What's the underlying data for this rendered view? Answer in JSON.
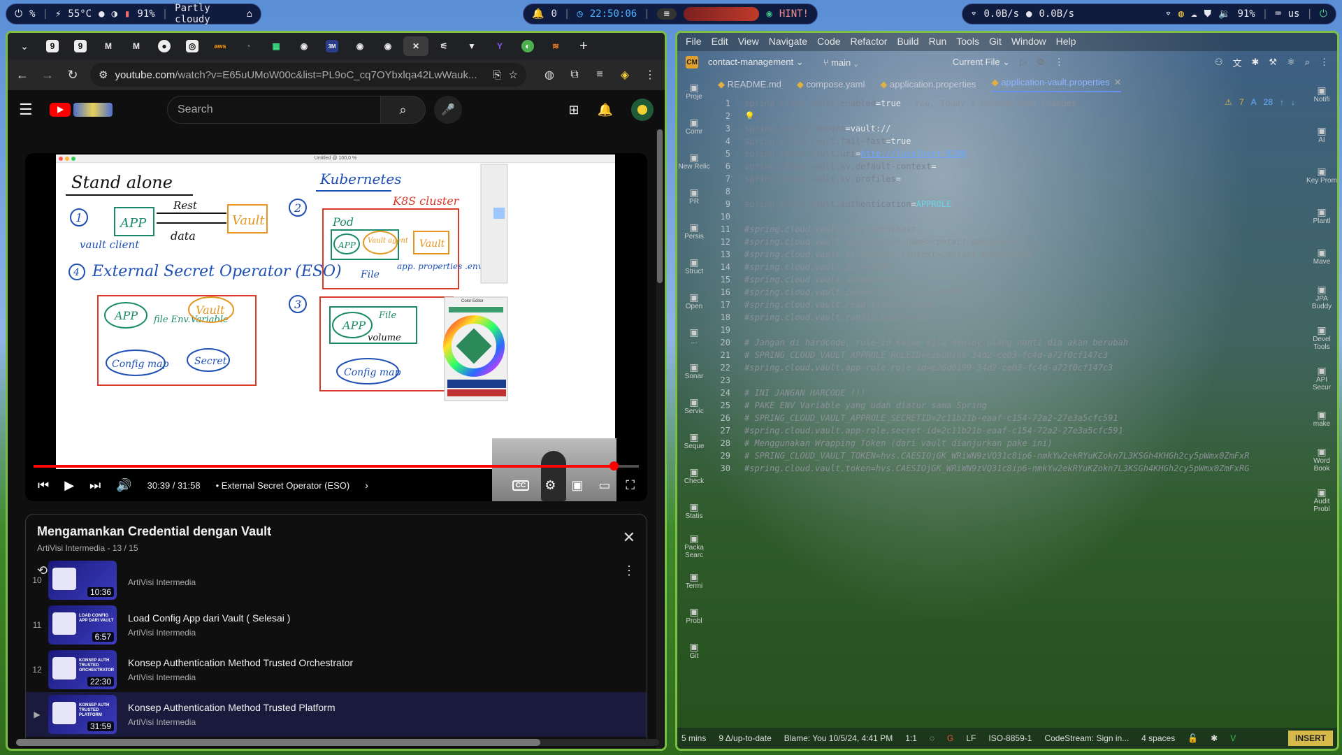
{
  "topbar": {
    "left": {
      "temp": "55°C",
      "battery": "91%",
      "weather": "Partly cloudy"
    },
    "center": {
      "notifications": "0",
      "clock": "22:50:06",
      "hint": "HINT!"
    },
    "right": {
      "net_up": "0.0B/s",
      "net_down": "0.0B/s",
      "volume": "91%",
      "lang": "us"
    }
  },
  "browser": {
    "url_main": "youtube.com",
    "url_rest": "/watch?v=E65uUMoW00c&list=PL9oC_cq7OYbxlqa42LwWauk...",
    "search_placeholder": "Search"
  },
  "video": {
    "canvas_title": "Untitled @ 100,0 %",
    "time": "30:39 / 31:58",
    "chapter": "• External Secret Operator (ESO)",
    "progress_fraction": 0.959,
    "whiteboard": {
      "standalone": "Stand alone",
      "kubernetes": "Kubernetes",
      "k8s_cluster": "K8S cluster",
      "app": "APP",
      "rest": "Rest",
      "vault": "Vault",
      "data": "data",
      "vault_client": "vault client",
      "pod": "Pod",
      "vault_agent": "Vault agent",
      "file": "File",
      "app_properties": "app. properties .env",
      "eso": "External Secret Operator (ESO)",
      "file_env": "file Env.Variable",
      "config_map": "Config map",
      "secret": "Secret",
      "volume": "volume",
      "n1": "1",
      "n2": "2",
      "n3": "3",
      "n4": "4",
      "color_editor": "Color Editor"
    }
  },
  "playlist": {
    "title": "Mengamankan Credential dengan Vault",
    "channel": "ArtiVisi Intermedia",
    "position": "13 / 15",
    "items": [
      {
        "index": "10",
        "title": "",
        "channel": "ArtiVisi Intermedia",
        "duration": "10:36",
        "thumb": "",
        "current": false
      },
      {
        "index": "11",
        "title": "Load Config App dari Vault ( Selesai )",
        "channel": "ArtiVisi Intermedia",
        "duration": "6:57",
        "thumb": "LOAD CONFIG APP DARI VAULT",
        "current": false
      },
      {
        "index": "12",
        "title": "Konsep Authentication Method Trusted Orchestrator",
        "channel": "ArtiVisi Intermedia",
        "duration": "22:30",
        "thumb": "KONSEP AUTH TRUSTED ORCHESTRATOR",
        "current": false
      },
      {
        "index": "▶",
        "title": "Konsep Authentication Method Trusted Platform",
        "channel": "ArtiVisi Intermedia",
        "duration": "31:59",
        "thumb": "KONSEP AUTH TRUSTED PLATFORM",
        "current": true
      }
    ]
  },
  "ide": {
    "menu": [
      "File",
      "Edit",
      "View",
      "Navigate",
      "Code",
      "Refactor",
      "Build",
      "Run",
      "Tools",
      "Git",
      "Window",
      "Help"
    ],
    "project_badge": "CM",
    "project": "contact-management",
    "branch": "main",
    "run_config": "Current File",
    "tabs": [
      {
        "label": "README.md",
        "active": false
      },
      {
        "label": "compose.yaml",
        "active": false
      },
      {
        "label": "application.properties",
        "active": false
      },
      {
        "label": "application-vault.properties",
        "active": true
      }
    ],
    "left_rail": [
      "Proje",
      "Comr",
      "New Relic",
      "PR",
      "Persis",
      "Struct",
      "Open",
      "…",
      "Sonar",
      "Servic",
      "Seque",
      "Check",
      "Statis",
      "Packa Searc",
      "Termi",
      "Probl",
      "Git"
    ],
    "right_rail": [
      "Notifi",
      "AI",
      "Key Prom",
      "Plantl",
      "Mave",
      "JPA Buddy",
      "Devel Tools",
      "API Secur",
      "make",
      "Word Book",
      "Audit Probl"
    ],
    "inspections": {
      "warnings": "7",
      "typos": "28"
    },
    "blame_hint": "You, Today • Uncommitted changes",
    "lines": [
      {
        "n": "1",
        "text": "spring.cloud.vault.enabled=true"
      },
      {
        "n": "2",
        "text": ""
      },
      {
        "n": "3",
        "text": "spring.config.import=vault://"
      },
      {
        "n": "4",
        "text": "spring.cloud.vault.fail-fast=true"
      },
      {
        "n": "5",
        "text": "spring.cloud.vault.uri=http://localhost:8288"
      },
      {
        "n": "6",
        "text": "spring.cloud.vault.kv.default-context="
      },
      {
        "n": "7",
        "text": "spring.cloud.vault.kv.profiles="
      },
      {
        "n": "8",
        "text": ""
      },
      {
        "n": "9",
        "text": "spring.cloud.vault.authentication=APPROLE"
      },
      {
        "n": "10",
        "text": ""
      },
      {
        "n": "11",
        "text": "#spring.cloud.vault.host=localhost"
      },
      {
        "n": "12",
        "text": "#spring.cloud.vault.application-name=contact-management"
      },
      {
        "n": "13",
        "text": "#spring.cloud.vault.kv.default-context=contact-management"
      },
      {
        "n": "14",
        "text": "#spring.cloud.vault.port=8288"
      },
      {
        "n": "15",
        "text": "#spring.cloud.vault.scheme=http"
      },
      {
        "n": "16",
        "text": "#spring.cloud.vault.connection-timeout=5000"
      },
      {
        "n": "17",
        "text": "#spring.cloud.vault.read-timeout=15000"
      },
      {
        "n": "18",
        "text": "#spring.cloud.vault.config.order=-10"
      },
      {
        "n": "19",
        "text": ""
      },
      {
        "n": "20",
        "text": "# Jangan di hardcode, role-id kalau kita deploy ulang nanti dia akan berubah"
      },
      {
        "n": "21",
        "text": "# SPRING_CLOUD_VAULT_APPROLE_ROLEID=e26d0199-34d2-ce03-fc4d-a72f0cf147c3"
      },
      {
        "n": "22",
        "text": "#spring.cloud.vault.app-role.role-id=e26d0199-34d2-ce03-fc4d-a72f0cf147c3"
      },
      {
        "n": "23",
        "text": ""
      },
      {
        "n": "24",
        "text": "# INI JANGAN HARCODE !!!"
      },
      {
        "n": "25",
        "text": "# PAKE ENV Variable yang udah diatur sama Spring"
      },
      {
        "n": "26",
        "text": "# SPRING_CLOUD_VAULT_APPROLE_SECRETID=2c11b21b-eaaf-c154-72a2-27e3a5cfc591"
      },
      {
        "n": "27",
        "text": "#spring.cloud.vault.app-role.secret-id=2c11b21b-eaaf-c154-72a2-27e3a5cfc591"
      },
      {
        "n": "28",
        "text": "# Menggunakan Wrapping Token (dari vault dianjurkan pake ini)"
      },
      {
        "n": "29",
        "text": "# SPRING_CLOUD_VAULT_TOKEN=hvs.CAESIOjGK_WRiWN9zVQ31c8ip6-nmkYw2ekRYuKZokn7L3KSGh4KHGh2cy5pWmx0ZmFxR"
      },
      {
        "n": "30",
        "text": "#spring.cloud.vault.token=hvs.CAESIOjGK_WRiWN9zVQ31c8ip6-nmkYw2ekRYuKZokn7L3KSGh4KHGh2cy5pWmx0ZmFxRG"
      }
    ],
    "status": {
      "time": "5 mins",
      "vcs": "9 Δ/up-to-date",
      "blame": "Blame: You 10/5/24, 4:41 PM",
      "pos": "1:1",
      "lf": "LF",
      "encoding": "ISO-8859-1",
      "codestream": "CodeStream: Sign in...",
      "indent": "4 spaces",
      "mode": "INSERT"
    }
  }
}
